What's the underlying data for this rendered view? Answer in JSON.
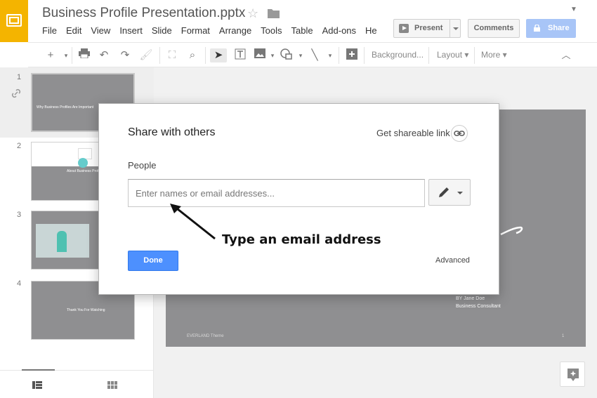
{
  "header": {
    "doc_title": "Business Profile Presentation.pptx",
    "menu": [
      "File",
      "Edit",
      "View",
      "Insert",
      "Slide",
      "Format",
      "Arrange",
      "Tools",
      "Table",
      "Add-ons",
      "He"
    ],
    "present_label": "Present",
    "comments_label": "Comments",
    "share_label": "Share"
  },
  "toolbar": {
    "background_label": "Background...",
    "layout_label": "Layout",
    "more_label": "More"
  },
  "filmstrip": {
    "slides": [
      {
        "num": "1",
        "text": "Why Business Profiles Are Important"
      },
      {
        "num": "2",
        "text": "About Business Profile"
      },
      {
        "num": "3",
        "text": ""
      },
      {
        "num": "4",
        "text": "Thank You For Watching"
      }
    ]
  },
  "slide": {
    "byline_1": "BY Jane Doe",
    "byline_2": "Business Consultant",
    "theme": "EVERLAND Theme",
    "page": "1"
  },
  "dialog": {
    "title": "Share with others",
    "shareable_link": "Get shareable link",
    "people_label": "People",
    "input_placeholder": "Enter names or email addresses...",
    "done_label": "Done",
    "advanced_label": "Advanced"
  },
  "annotation": {
    "text": "Type an email address"
  },
  "colors": {
    "brand": "#f4b400",
    "primary_button": "#4d90fe",
    "share_disabled": "#a8c5f7",
    "slide_bg": "#8f8f91"
  }
}
